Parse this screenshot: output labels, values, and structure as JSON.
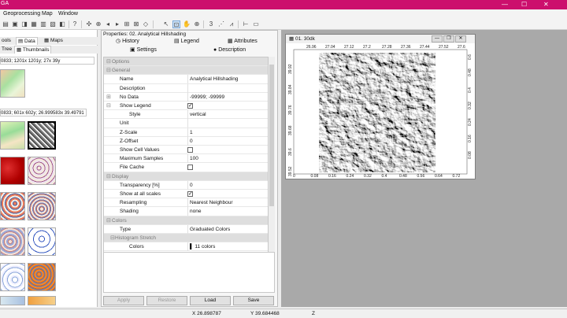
{
  "title_bar": {
    "app_fragment": "GA",
    "minimize": "—",
    "maximize": "☐",
    "close": "✕"
  },
  "menu": [
    "Geoprocessing",
    "Map",
    "Window"
  ],
  "left_panel": {
    "tabs": [
      "ools",
      "Data",
      "Maps"
    ],
    "subtabs": [
      "Tree",
      "Thumbnails"
    ],
    "info1": "0833; 1201x 1201y; 27x 39y",
    "info2": "0833; 601x 602y; 26.999583x 39.49791"
  },
  "properties": {
    "title": "Properties: 02. Analytical Hillshading",
    "tabs_row1": [
      "History",
      "Legend",
      "Attributes"
    ],
    "tabs_row2": [
      "Settings",
      "Description"
    ],
    "section_options": "Options",
    "rows": [
      {
        "type": "cat",
        "label": "General"
      },
      {
        "label": "Name",
        "value": "Analytical Hillshading"
      },
      {
        "label": "Description",
        "value": ""
      },
      {
        "label": "No Data",
        "value": "-99999; -99999",
        "expand": "⊞"
      },
      {
        "label": "Show Legend",
        "check": "✓",
        "expand": "⊟"
      },
      {
        "label": "Style",
        "value": "vertical",
        "sub": true
      },
      {
        "label": "Unit",
        "value": ""
      },
      {
        "label": "Z-Scale",
        "value": "1"
      },
      {
        "label": "Z-Offset",
        "value": "0"
      },
      {
        "label": "Show Cell Values",
        "check": ""
      },
      {
        "label": "Maximum Samples",
        "value": "100"
      },
      {
        "label": "File Cache",
        "check": ""
      },
      {
        "type": "cat",
        "label": "Display"
      },
      {
        "label": "Transparency [%]",
        "value": "0"
      },
      {
        "label": "Show at all scales",
        "check": "✓"
      },
      {
        "label": "Resampling",
        "value": "Nearest Neighbour"
      },
      {
        "label": "Shading",
        "value": "none"
      },
      {
        "type": "cat",
        "label": "Colors"
      },
      {
        "label": "Type",
        "value": "Graduated Colors"
      },
      {
        "type": "cat",
        "label": "Histogram Stretch",
        "sub": true
      },
      {
        "label": "Colors",
        "value": "11 colors",
        "sub": true
      }
    ],
    "buttons": [
      "Apply",
      "Restore",
      "Load",
      "Save"
    ]
  },
  "map_window": {
    "title": "01. 30dk",
    "x_top": [
      "26.96",
      "27.04",
      "27.12",
      "27.2",
      "27.28",
      "27.36",
      "27.44",
      "27.52",
      "27.6"
    ],
    "x_bottom": [
      "0",
      "0.08",
      "0.16",
      "0.24",
      "0.32",
      "0.4",
      "0.48",
      "0.56",
      "0.64",
      "0.72"
    ],
    "y_left": [
      "39.92",
      "39.84",
      "39.76",
      "39.68",
      "39.6",
      "39.52"
    ],
    "y_right": [
      "0.6",
      "0.48",
      "0.4",
      "0.32",
      "0.24",
      "0.16",
      "0.08"
    ]
  },
  "status": {
    "x": "X 26.898787",
    "y": "Y 39.684468",
    "z": "Z"
  }
}
